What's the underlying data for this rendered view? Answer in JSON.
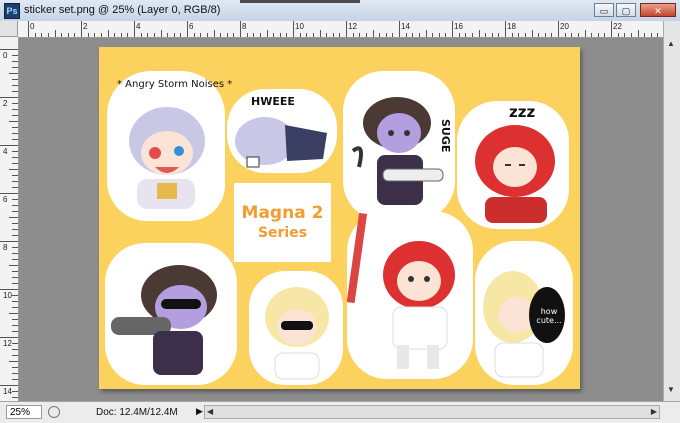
{
  "window": {
    "title": "sticker set.png @ 25% (Layer 0, RGB/8)",
    "app_icon_label": "Ps",
    "controls": {
      "minimize": "▭",
      "restore": "▢",
      "close": "✕"
    }
  },
  "rulers": {
    "horizontal": [
      "0",
      "2",
      "4",
      "6",
      "8",
      "10",
      "12",
      "14",
      "16",
      "18",
      "20",
      "22",
      "24"
    ],
    "vertical": [
      "0",
      "2",
      "4",
      "6",
      "8",
      "10",
      "12",
      "14"
    ]
  },
  "statusbar": {
    "zoom": "25%",
    "doc": "Doc: 12.4M/12.4M",
    "menu_arrow": "▶"
  },
  "artwork": {
    "center_title": "Magna 2",
    "center_subtitle": "Series",
    "stickers": {
      "angry": "* Angry Storm Noises *",
      "hweee": "HWEEE",
      "suge": "SUGE",
      "zzz": "zzz",
      "how_cute": "how cute..."
    }
  },
  "colors": {
    "canvas_bg": "#fcd25e",
    "workspace": "#8d8d8d",
    "title_accent": "#f29c32"
  }
}
